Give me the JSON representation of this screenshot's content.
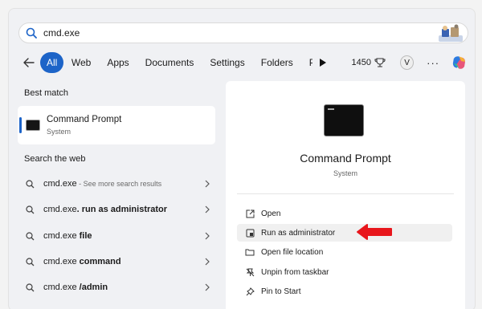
{
  "search": {
    "value": "cmd.exe"
  },
  "tabs": [
    "All",
    "Web",
    "Apps",
    "Documents",
    "Settings",
    "Folders",
    "P"
  ],
  "header": {
    "points": "1450",
    "avatar": "V",
    "more": "···"
  },
  "left": {
    "best_match_title": "Best match",
    "best_match": {
      "name": "Command Prompt",
      "type": "System"
    },
    "web_title": "Search the web",
    "web_items": [
      {
        "prefix": "cmd.exe",
        "bold": "",
        "hint": " - See more search results"
      },
      {
        "prefix": "cmd.exe",
        "bold": ". run as administrator",
        "hint": ""
      },
      {
        "prefix": "cmd.exe ",
        "bold": "file",
        "hint": ""
      },
      {
        "prefix": "cmd.exe ",
        "bold": "command",
        "hint": ""
      },
      {
        "prefix": "cmd.exe ",
        "bold": "/admin",
        "hint": ""
      }
    ]
  },
  "right": {
    "app_name": "Command Prompt",
    "app_type": "System",
    "actions": [
      "Open",
      "Run as administrator",
      "Open file location",
      "Unpin from taskbar",
      "Pin to Start"
    ]
  },
  "colors": {
    "accent": "#1d64c8",
    "arrow": "#e8161c"
  }
}
